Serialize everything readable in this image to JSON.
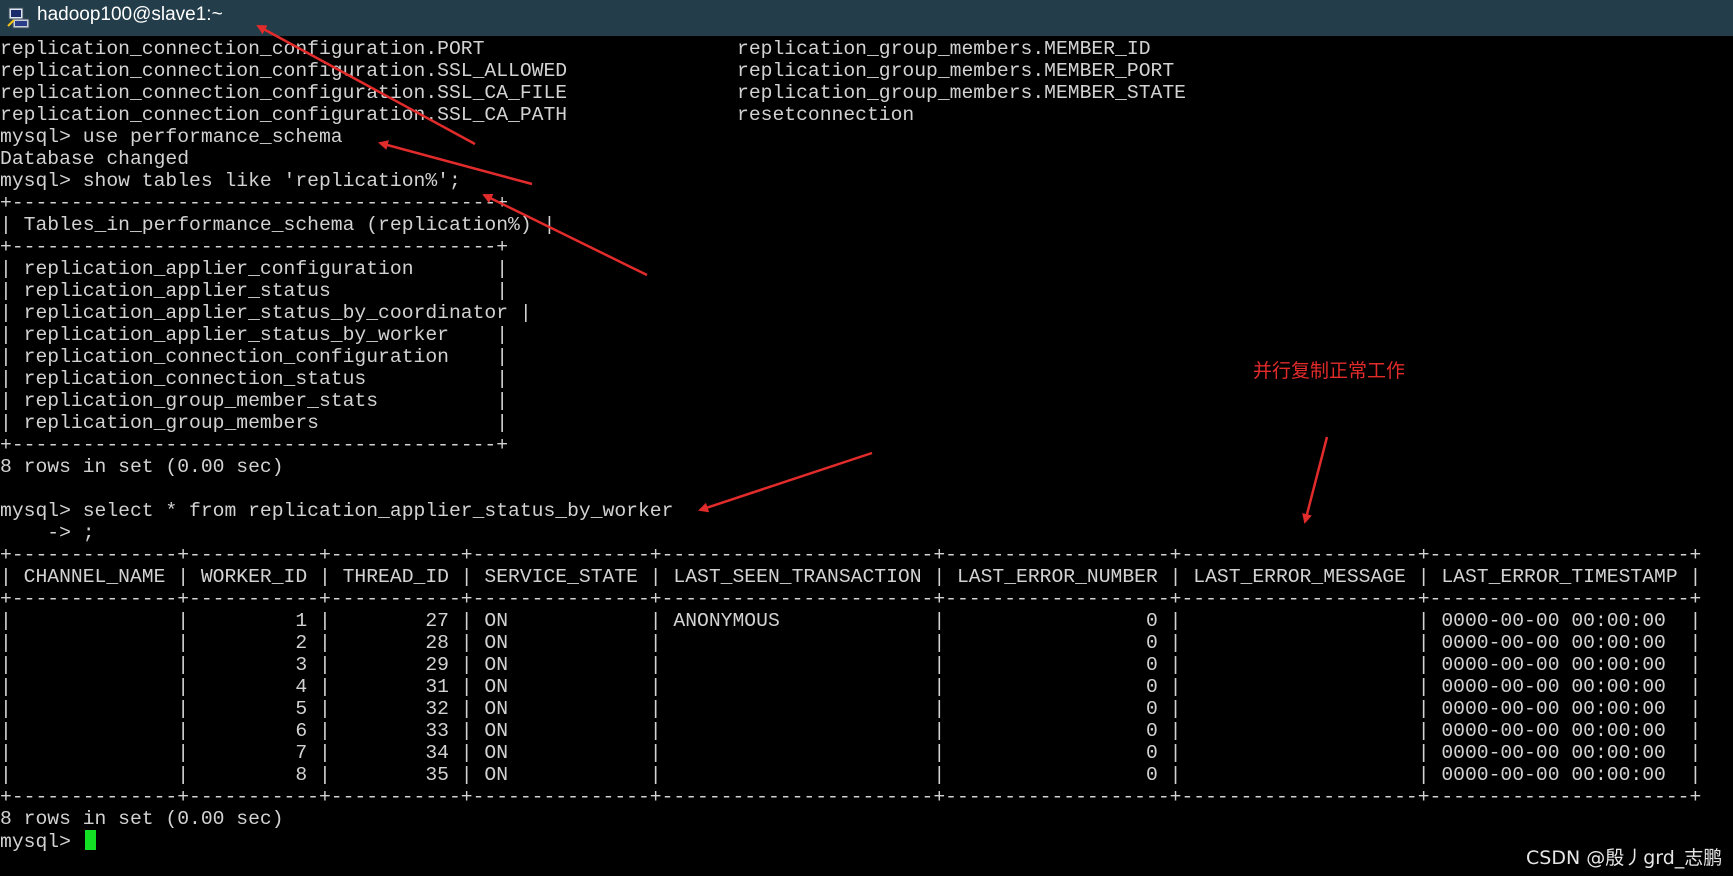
{
  "window": {
    "title": "hadoop100@slave1:~",
    "icon": "putty-terminal-icon"
  },
  "terminal": {
    "top_left": [
      "replication_connection_configuration.PORT",
      "replication_connection_configuration.SSL_ALLOWED",
      "replication_connection_configuration.SSL_CA_FILE",
      "replication_connection_configuration.SSL_CA_PATH"
    ],
    "top_right": [
      "replication_group_members.MEMBER_ID",
      "replication_group_members.MEMBER_PORT",
      "replication_group_members.MEMBER_STATE",
      "resetconnection"
    ],
    "lines": [
      "mysql> use performance_schema",
      "Database changed",
      "mysql> show tables like 'replication%';",
      "+-----------------------------------------+",
      "| Tables_in_performance_schema (replication%) |",
      "+-----------------------------------------+",
      "| replication_applier_configuration       |",
      "| replication_applier_status              |",
      "| replication_applier_status_by_coordinator |",
      "| replication_applier_status_by_worker    |",
      "| replication_connection_configuration    |",
      "| replication_connection_status           |",
      "| replication_group_member_stats          |",
      "| replication_group_members               |",
      "+-----------------------------------------+",
      "8 rows in set (0.00 sec)",
      "",
      "mysql> select * from replication_applier_status_by_worker",
      "    -> ;",
      "+--------------+-----------+-----------+---------------+-----------------------+-------------------+--------------------+----------------------+",
      "| CHANNEL_NAME | WORKER_ID | THREAD_ID | SERVICE_STATE | LAST_SEEN_TRANSACTION | LAST_ERROR_NUMBER | LAST_ERROR_MESSAGE | LAST_ERROR_TIMESTAMP |",
      "+--------------+-----------+-----------+---------------+-----------------------+-------------------+--------------------+----------------------+",
      "|              |         1 |        27 | ON            | ANONYMOUS             |                 0 |                    | 0000-00-00 00:00:00  |",
      "|              |         2 |        28 | ON            |                       |                 0 |                    | 0000-00-00 00:00:00  |",
      "|              |         3 |        29 | ON            |                       |                 0 |                    | 0000-00-00 00:00:00  |",
      "|              |         4 |        31 | ON            |                       |                 0 |                    | 0000-00-00 00:00:00  |",
      "|              |         5 |        32 | ON            |                       |                 0 |                    | 0000-00-00 00:00:00  |",
      "|              |         6 |        33 | ON            |                       |                 0 |                    | 0000-00-00 00:00:00  |",
      "|              |         7 |        34 | ON            |                       |                 0 |                    | 0000-00-00 00:00:00  |",
      "|              |         8 |        35 | ON            |                       |                 0 |                    | 0000-00-00 00:00:00  |",
      "+--------------+-----------+-----------+---------------+-----------------------+-------------------+--------------------+----------------------+",
      "8 rows in set (0.00 sec)",
      ""
    ],
    "prompt": "mysql> ",
    "cursor_color": "#13e025"
  },
  "annotation": {
    "text": "并行复制正常工作",
    "color": "#e22b2b"
  },
  "watermark": "CSDN @殷丿grd_志鹏",
  "colors": {
    "titlebar": "#233d4a",
    "terminal_bg": "#000000",
    "terminal_fg": "#d2d2d2",
    "arrow": "#e22b2b"
  }
}
